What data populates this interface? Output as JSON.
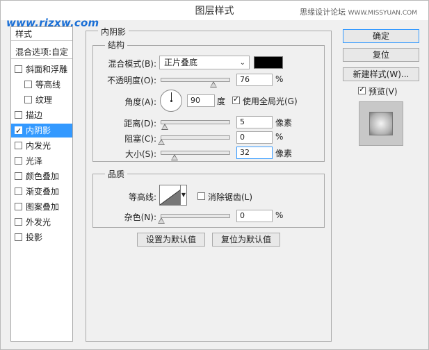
{
  "window": {
    "title": "图层样式"
  },
  "watermark": {
    "left": "www.rjzxw.com",
    "right": "思缘设计论坛",
    "right_site": "WWW.MISSYUAN.COM"
  },
  "left_panel": {
    "header": "样式",
    "blend_options": "混合选项:自定",
    "items": [
      {
        "label": "斜面和浮雕",
        "checked": false,
        "indent": false
      },
      {
        "label": "等高线",
        "checked": false,
        "indent": true
      },
      {
        "label": "纹理",
        "checked": false,
        "indent": true
      },
      {
        "label": "描边",
        "checked": false,
        "indent": false
      },
      {
        "label": "内阴影",
        "checked": true,
        "indent": false,
        "selected": true
      },
      {
        "label": "内发光",
        "checked": false,
        "indent": false
      },
      {
        "label": "光泽",
        "checked": false,
        "indent": false
      },
      {
        "label": "颜色叠加",
        "checked": false,
        "indent": false
      },
      {
        "label": "渐变叠加",
        "checked": false,
        "indent": false
      },
      {
        "label": "图案叠加",
        "checked": false,
        "indent": false
      },
      {
        "label": "外发光",
        "checked": false,
        "indent": false
      },
      {
        "label": "投影",
        "checked": false,
        "indent": false
      }
    ]
  },
  "inner_shadow": {
    "section_title": "内阴影",
    "structure_title": "结构",
    "blend_mode_label": "混合模式(B):",
    "blend_mode_value": "正片叠底",
    "swatch_color": "#000000",
    "opacity_label": "不透明度(O):",
    "opacity_value": "76",
    "opacity_unit": "%",
    "angle_label": "角度(A):",
    "angle_value": "90",
    "angle_unit": "度",
    "global_light_label": "使用全局光(G)",
    "global_light_checked": true,
    "distance_label": "距离(D):",
    "distance_value": "5",
    "distance_unit": "像素",
    "choke_label": "阻塞(C):",
    "choke_value": "0",
    "choke_unit": "%",
    "size_label": "大小(S):",
    "size_value": "32",
    "size_unit": "像素",
    "quality_title": "品质",
    "contour_label": "等高线:",
    "antialias_label": "消除锯齿(L)",
    "antialias_checked": false,
    "noise_label": "杂色(N):",
    "noise_value": "0",
    "noise_unit": "%",
    "make_default": "设置为默认值",
    "reset_default": "复位为默认值"
  },
  "right_buttons": {
    "ok": "确定",
    "reset": "复位",
    "new_style": "新建样式(W)...",
    "preview_label": "预览(V)",
    "preview_checked": true
  }
}
